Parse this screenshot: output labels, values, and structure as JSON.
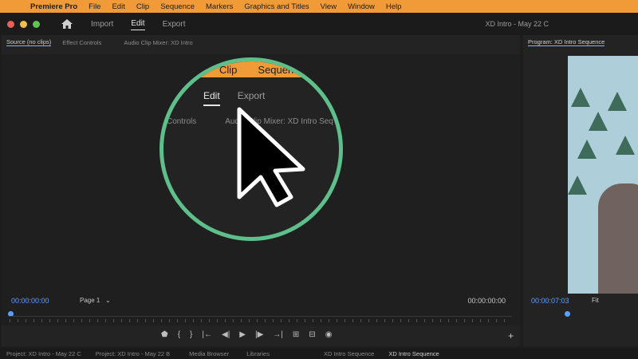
{
  "menubar": {
    "app": "Premiere Pro",
    "items": [
      "File",
      "Edit",
      "Clip",
      "Sequence",
      "Markers",
      "Graphics and Titles",
      "View",
      "Window",
      "Help"
    ]
  },
  "titlebar": {
    "tabs": [
      "Import",
      "Edit",
      "Export"
    ],
    "active": "Edit",
    "title": "XD Intro - May 22 C"
  },
  "source_panel": {
    "tabs": [
      "Source (no clips)",
      "Effect Controls",
      "Audio Clip Mixer: XD Intro"
    ],
    "timecode_left": "00:00:00:00",
    "page": "Page 1",
    "timecode_right": "00:00:00:00"
  },
  "program_panel": {
    "title": "Program: XD Intro Sequence",
    "timecode": "00:00:07:03",
    "fit": "Fit"
  },
  "zoom": {
    "strip_items": [
      "Clip",
      "Sequence"
    ],
    "tabs": [
      "Edit",
      "Export"
    ],
    "sub": [
      "Controls",
      "Audio Clip Mixer: XD Intro Seq"
    ]
  },
  "bottom": {
    "tabs": [
      "Project: XD Intro - May 22 C",
      "Project: XD Intro - May 22 B",
      "Media Browser",
      "Libraries"
    ],
    "seq_tabs": [
      "XD Intro Sequence",
      "XD Intro Sequence"
    ]
  },
  "colors": {
    "accent": "#f19b38",
    "highlight": "#5ebf8a",
    "timecode": "#5aa0ff"
  }
}
